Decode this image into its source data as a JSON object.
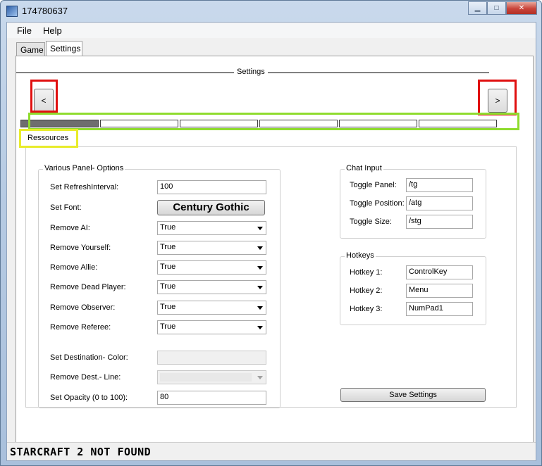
{
  "window": {
    "title": "174780637"
  },
  "menu": {
    "file": "File",
    "help": "Help"
  },
  "tabs": [
    {
      "label": "Game"
    },
    {
      "label": "Settings"
    }
  ],
  "settings_header": "Settings",
  "nav": {
    "prev": "<",
    "next": ">"
  },
  "progress": {
    "segments": 6,
    "current": 1
  },
  "section": "Ressources",
  "panel_options": {
    "title": "Various Panel- Options",
    "refresh_label": "Set RefreshInterval:",
    "refresh_value": "100",
    "font_label": "Set Font:",
    "font_button": "Century Gothic",
    "remove_ai_label": "Remove AI:",
    "remove_ai_value": "True",
    "remove_yourself_label": "Remove Yourself:",
    "remove_yourself_value": "True",
    "remove_allie_label": "Remove Allie:",
    "remove_allie_value": "True",
    "remove_dead_label": "Remove Dead Player:",
    "remove_dead_value": "True",
    "remove_observer_label": "Remove Observer:",
    "remove_observer_value": "True",
    "remove_referee_label": "Remove Referee:",
    "remove_referee_value": "True",
    "dest_color_label": "Set Destination- Color:",
    "dest_line_label": "Remove Dest.- Line:",
    "opacity_label": "Set Opacity (0 to 100):",
    "opacity_value": "80"
  },
  "chat_input": {
    "title": "Chat Input",
    "toggle_panel_label": "Toggle Panel:",
    "toggle_panel_value": "/tg",
    "toggle_position_label": "Toggle Position:",
    "toggle_position_value": "/atg",
    "toggle_size_label": "Toggle Size:",
    "toggle_size_value": "/stg"
  },
  "hotkeys": {
    "title": "Hotkeys",
    "hotkey1_label": "Hotkey 1:",
    "hotkey1_value": "ControlKey",
    "hotkey2_label": "Hotkey 2:",
    "hotkey2_value": "Menu",
    "hotkey3_label": "Hotkey 3:",
    "hotkey3_value": "NumPad1"
  },
  "save_button": "Save Settings",
  "status": "STARCRAFT 2 NOT FOUND",
  "colors": {
    "highlight_red": "#e01010",
    "highlight_green": "#8fdc2e",
    "highlight_yellow": "#e8ec2b"
  }
}
